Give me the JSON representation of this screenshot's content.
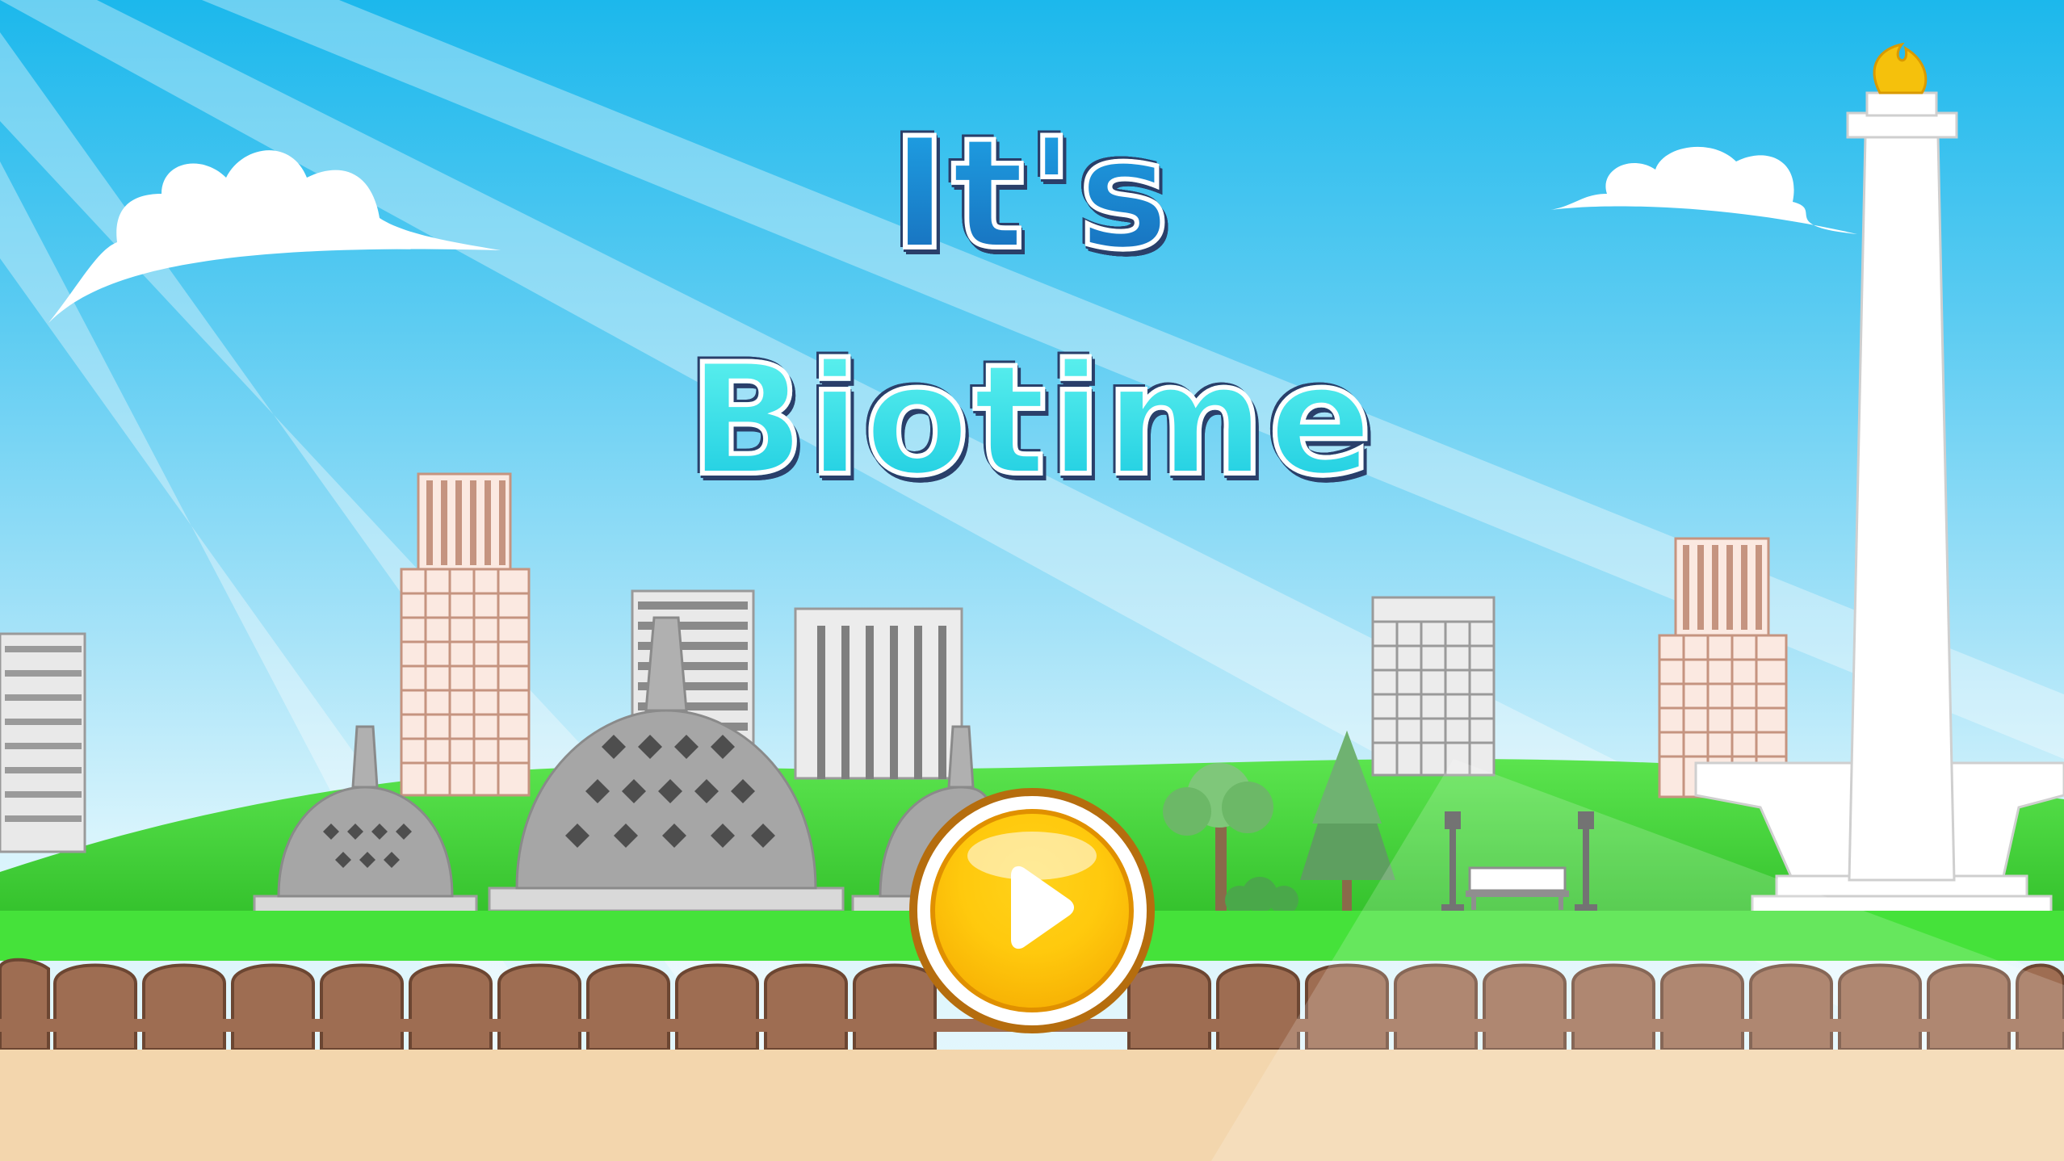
{
  "game": {
    "title_line1": "It's",
    "title_line2": "Biotime"
  },
  "controls": {
    "play_button_icon": "play-icon"
  },
  "colors": {
    "sky_top": "#1cb8ec",
    "grass": "#45e23a",
    "fence": "#9e6d52",
    "ground": "#f3d6ad",
    "play_button": "#ffc90d"
  }
}
